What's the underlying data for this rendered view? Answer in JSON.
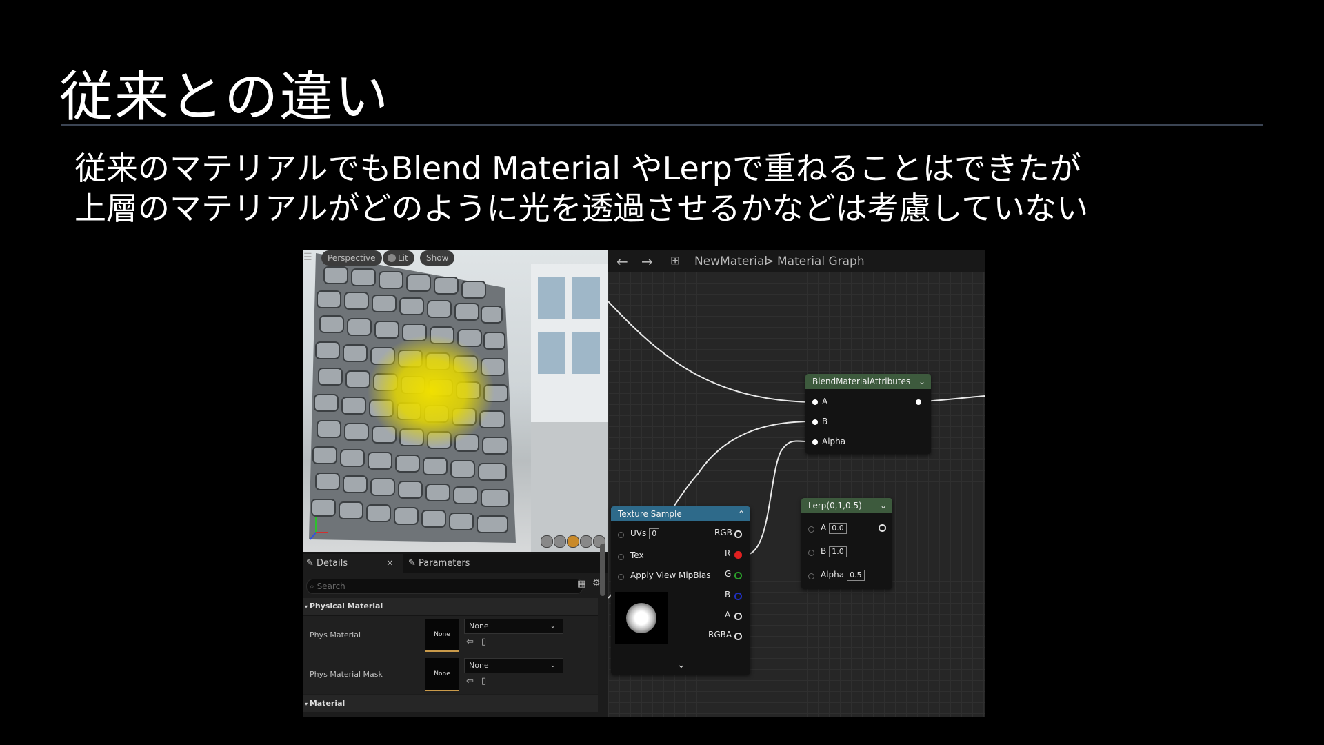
{
  "slide": {
    "title": "従来との違い",
    "lines": [
      "従来のマテリアルでもBlend Material やLerpで重ねることはできたが",
      "上層のマテリアルがどのように光を透過させるかなどは考慮していない"
    ]
  },
  "viewport": {
    "buttons": {
      "perspective": "Perspective",
      "lit": "Lit",
      "show": "Show"
    },
    "menu_icon": "hamburger-icon",
    "view_mode_icons": [
      "sphere-icon",
      "sphere-icon",
      "sphere-icon",
      "sphere-icon",
      "sphere-icon"
    ],
    "preview_colors": {
      "stone": "#8c9196",
      "blob": "#e6d800"
    }
  },
  "details_panel": {
    "tabs": {
      "details": "Details",
      "close": "×",
      "parameters": "Parameters"
    },
    "search_placeholder": "Search",
    "sections": {
      "physical_material": "Physical Material",
      "material": "Material"
    },
    "properties": [
      {
        "label": "Phys Material",
        "thumb": "None",
        "value": "None"
      },
      {
        "label": "Phys Material Mask",
        "thumb": "None",
        "value": "None"
      }
    ]
  },
  "graph": {
    "breadcrumb": {
      "asset": "NewMaterial",
      "separator": ">",
      "graph": "Material Graph"
    },
    "nodes": {
      "blend": {
        "title": "BlendMaterialAttributes",
        "inputs": [
          "A",
          "B",
          "Alpha"
        ]
      },
      "texture_sample": {
        "title": "Texture Sample",
        "inputs": [
          {
            "label": "UVs",
            "value": "0"
          },
          {
            "label": "Tex"
          },
          {
            "label": "Apply View MipBias"
          }
        ],
        "outputs": [
          "RGB",
          "R",
          "G",
          "B",
          "A",
          "RGBA"
        ]
      },
      "lerp": {
        "title": "Lerp(0,1,0.5)",
        "inputs": [
          {
            "label": "A",
            "value": "0.0"
          },
          {
            "label": "B",
            "value": "1.0"
          },
          {
            "label": "Alpha",
            "value": "0.5"
          }
        ]
      }
    },
    "colors": {
      "blend_header": "#3d5a3d",
      "texture_header": "#2e6a8a",
      "lerp_header": "#3d5a3d",
      "pin_r": "#e02020",
      "pin_g": "#2aa02a",
      "pin_b": "#2030c0"
    }
  }
}
